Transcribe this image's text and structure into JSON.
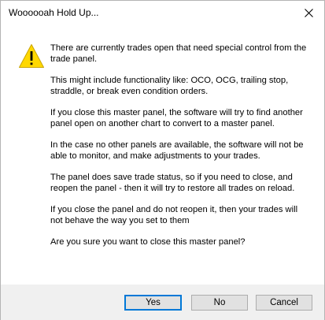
{
  "window": {
    "title": "Woooooah Hold Up...",
    "close_glyph": "close-icon"
  },
  "dialog": {
    "icon": "warning-icon",
    "paragraphs": [
      "There are currently trades open that need special control from the trade panel.",
      "This might include functionality like: OCO, OCG, trailing stop, straddle, or break even condition orders.",
      "If you close this master panel, the software will try to find another panel open on another chart to convert to a master panel.",
      "In the case no other panels are available, the software will not be able to monitor, and make adjustments to your trades.",
      "The panel does save trade status, so if you need to close, and reopen the panel - then it will try to restore all trades on reload.",
      "If you close the panel and do not reopen it, then your trades will not behave the way you set to them",
      "Are you sure you want to close this master panel?"
    ]
  },
  "buttons": {
    "yes": "Yes",
    "no": "No",
    "cancel": "Cancel"
  },
  "colors": {
    "footer_bg": "#f0f0f0",
    "button_bg": "#e1e1e1",
    "button_border": "#adadad",
    "default_button_border": "#0078d7",
    "warning_yellow": "#ffd800"
  }
}
